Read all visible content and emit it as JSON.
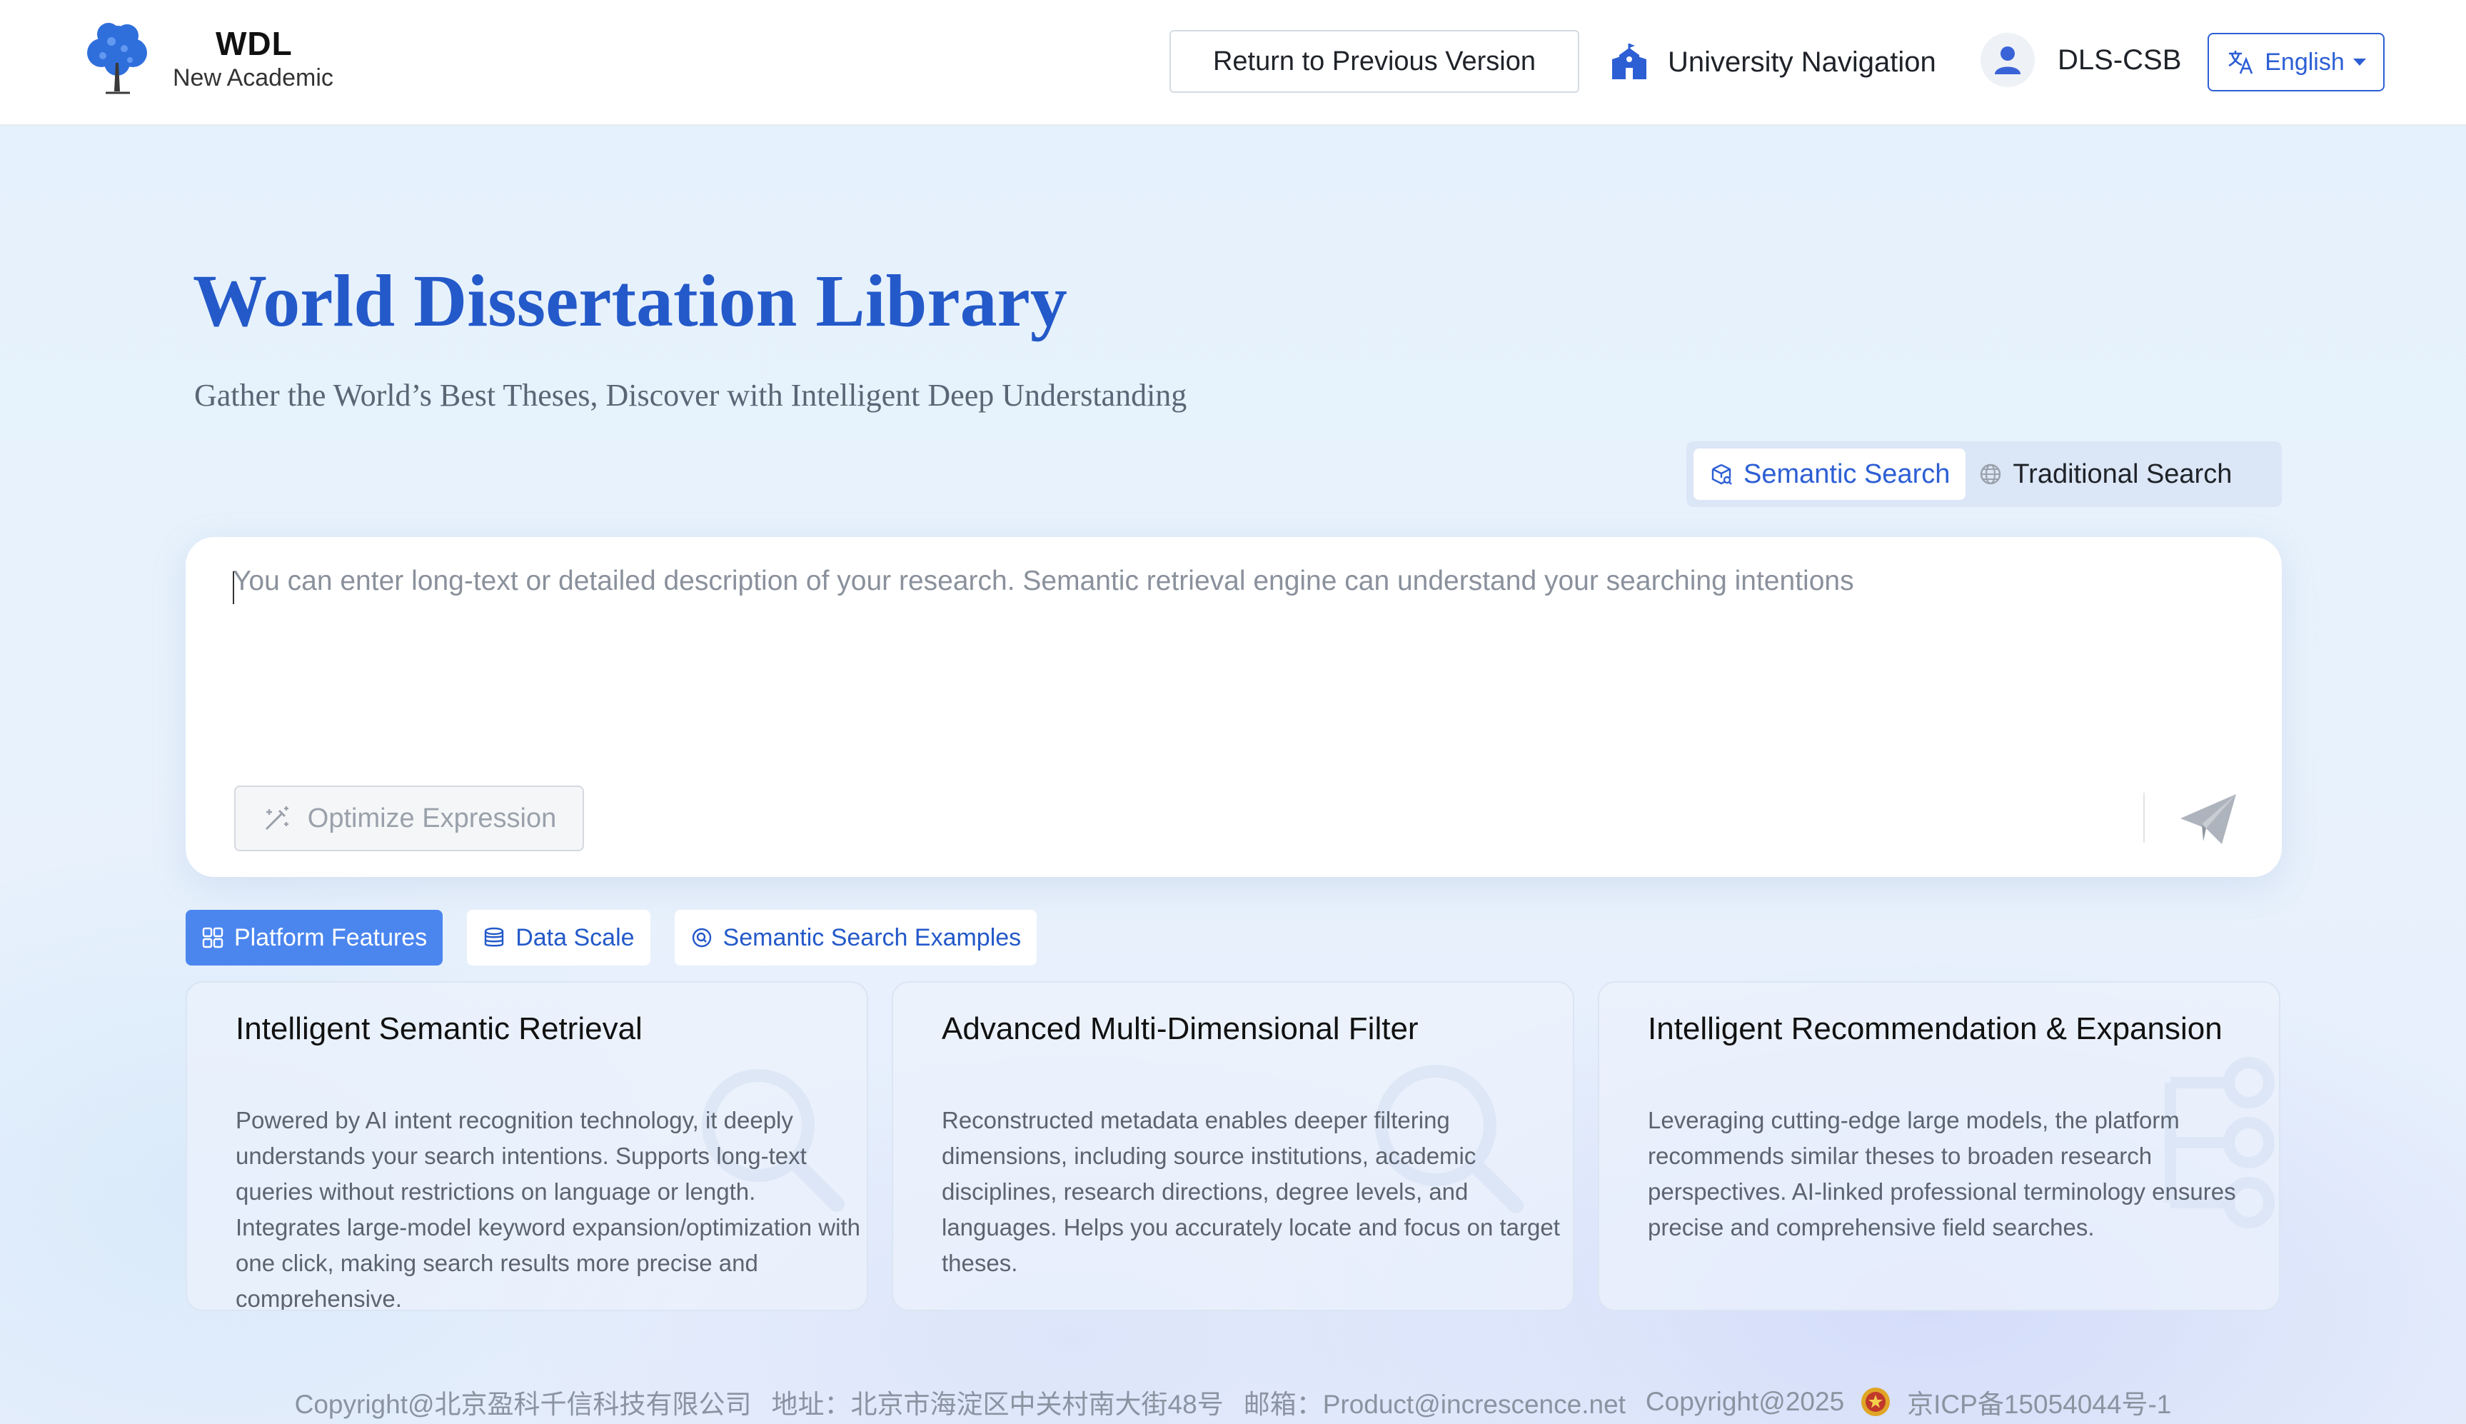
{
  "header": {
    "logo_title": "WDL",
    "logo_subtitle": "New Academic",
    "prev_version": "Return to Previous Version",
    "university_nav": "University Navigation",
    "user_name": "DLS-CSB",
    "language": "English"
  },
  "hero": {
    "title": "World Dissertation Library",
    "subtitle": "Gather the World’s Best Theses, Discover with Intelligent Deep Understanding"
  },
  "search_modes": {
    "semantic": "Semantic Search",
    "traditional": "Traditional Search"
  },
  "search": {
    "placeholder": "You can enter long-text or detailed description of your research. Semantic retrieval engine can understand your searching intentions",
    "optimize_label": "Optimize Expression"
  },
  "feature_tabs": [
    {
      "label": "Platform Features"
    },
    {
      "label": "Data Scale"
    },
    {
      "label": "Semantic Search Examples"
    }
  ],
  "cards": [
    {
      "title": "Intelligent Semantic Retrieval",
      "text": "Powered by AI intent recognition technology, it deeply understands your search intentions. Supports long-text queries without restrictions on language or length. Integrates large-model keyword expansion/optimization with one click, making search results more precise and comprehensive."
    },
    {
      "title": "Advanced Multi-Dimensional Filter",
      "text": "Reconstructed metadata enables deeper filtering dimensions, including source institutions, academic disciplines, research directions, degree levels, and languages. Helps you accurately locate and focus on target theses."
    },
    {
      "title": "Intelligent Recommendation & Expansion",
      "text": "Leveraging cutting-edge large models, the platform recommends similar theses to broaden research perspectives. AI-linked professional terminology ensures precise and comprehensive field searches."
    }
  ],
  "footer": {
    "company": "Copyright@北京盈科千信科技有限公司",
    "address": "地址：北京市海淀区中关村南大街48号",
    "email": "邮箱：Product@increscence.net",
    "copyright_year": "Copyright@2025",
    "icp": "京ICP备15054044号-1"
  },
  "colors": {
    "accent": "#2d5fd4",
    "title_blue": "#2459c9",
    "active_tab": "#4b86ef",
    "page_bg": "#e9f2fb"
  },
  "icons": {
    "logo": "blue-tree-logo",
    "university": "school-building-icon",
    "user": "user-avatar-icon",
    "language": "translate-icon",
    "semantic": "cube-search-icon",
    "traditional": "globe-icon",
    "optimize": "magic-wand-icon",
    "send": "paper-plane-icon",
    "platform_features": "grid-icon",
    "data_scale": "database-icon",
    "semantic_examples": "search-circle-icon"
  }
}
